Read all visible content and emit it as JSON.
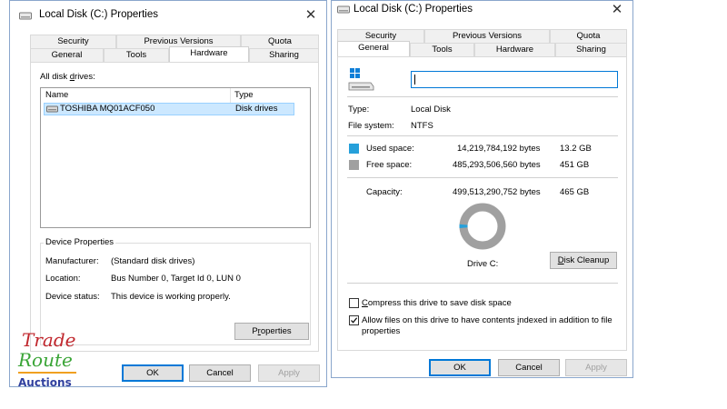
{
  "hardware_dialog": {
    "title": "Local Disk (C:) Properties",
    "tabs_row1": [
      "Security",
      "Previous Versions",
      "Quota"
    ],
    "tabs_row2": [
      "General",
      "Tools",
      "Hardware",
      "Sharing"
    ],
    "selected_tab": "Hardware",
    "list_label": "All disk drives:",
    "columns": [
      "Name",
      "Type"
    ],
    "rows": [
      {
        "name": "TOSHIBA MQ01ACF050",
        "type": "Disk drives"
      }
    ],
    "device_properties": {
      "group_title": "Device Properties",
      "manufacturer_label": "Manufacturer:",
      "manufacturer_value": "(Standard disk drives)",
      "location_label": "Location:",
      "location_value": "Bus Number 0, Target Id 0, LUN 0",
      "status_label": "Device status:",
      "status_value": "This device is working properly.",
      "properties_button": "Properties"
    },
    "buttons": {
      "ok": "OK",
      "cancel": "Cancel",
      "apply": "Apply"
    }
  },
  "general_dialog": {
    "title": "Local Disk (C:) Properties",
    "tabs_row1": [
      "Security",
      "Previous Versions",
      "Quota"
    ],
    "tabs_row2": [
      "General",
      "Tools",
      "Hardware",
      "Sharing"
    ],
    "selected_tab": "General",
    "name_input_value": "",
    "type_label": "Type:",
    "type_value": "Local Disk",
    "fs_label": "File system:",
    "fs_value": "NTFS",
    "used_label": "Used space:",
    "used_bytes": "14,219,784,192 bytes",
    "used_gb": "13.2 GB",
    "free_label": "Free space:",
    "free_bytes": "485,293,506,560 bytes",
    "free_gb": "451 GB",
    "capacity_label": "Capacity:",
    "capacity_bytes": "499,513,290,752 bytes",
    "capacity_gb": "465 GB",
    "drive_label": "Drive C:",
    "cleanup_button": "Disk Cleanup",
    "compress_label": "Compress this drive to save disk space",
    "compress_checked": false,
    "index_label_line1": "Allow files on this drive to have contents indexed in addition to file",
    "index_label_line2": "properties",
    "index_checked": true,
    "buttons": {
      "ok": "OK",
      "cancel": "Cancel",
      "apply": "Apply"
    },
    "used_fraction": 0.0285,
    "colors": {
      "used": "#26a0da",
      "free": "#a0a0a0"
    }
  },
  "watermark": {
    "line1": "Trade",
    "line2": "Route",
    "line3": "Auctions"
  }
}
